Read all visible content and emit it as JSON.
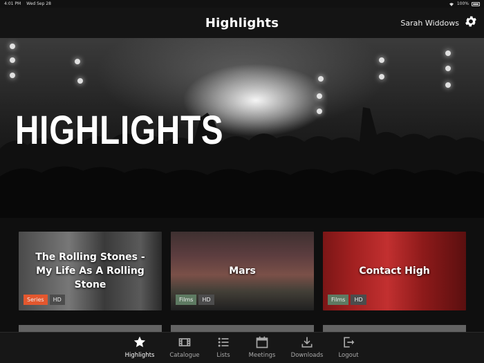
{
  "status_bar": {
    "time": "4:01 PM",
    "date": "Wed Sep 28",
    "battery": "100%"
  },
  "header": {
    "title": "Highlights",
    "user": "Sarah Widdows"
  },
  "hero": {
    "title": "HIGHLIGHTS"
  },
  "cards": [
    {
      "title": "The Rolling Stones - My Life As A Rolling Stone",
      "tags": [
        "Series",
        "HD"
      ]
    },
    {
      "title": "Mars",
      "tags": [
        "Films",
        "HD"
      ]
    },
    {
      "title": "Contact High",
      "tags": [
        "Films",
        "HD"
      ]
    }
  ],
  "tabs": [
    {
      "label": "Highlights",
      "icon": "star-icon",
      "active": true
    },
    {
      "label": "Catalogue",
      "icon": "film-icon",
      "active": false
    },
    {
      "label": "Lists",
      "icon": "list-icon",
      "active": false
    },
    {
      "label": "Meetings",
      "icon": "calendar-icon",
      "active": false
    },
    {
      "label": "Downloads",
      "icon": "download-icon",
      "active": false
    },
    {
      "label": "Logout",
      "icon": "logout-icon",
      "active": false
    }
  ],
  "colors": {
    "series_tag": "#e4572e",
    "films_tag": "#5e7a62",
    "hd_tag": "#4c4c4c"
  }
}
